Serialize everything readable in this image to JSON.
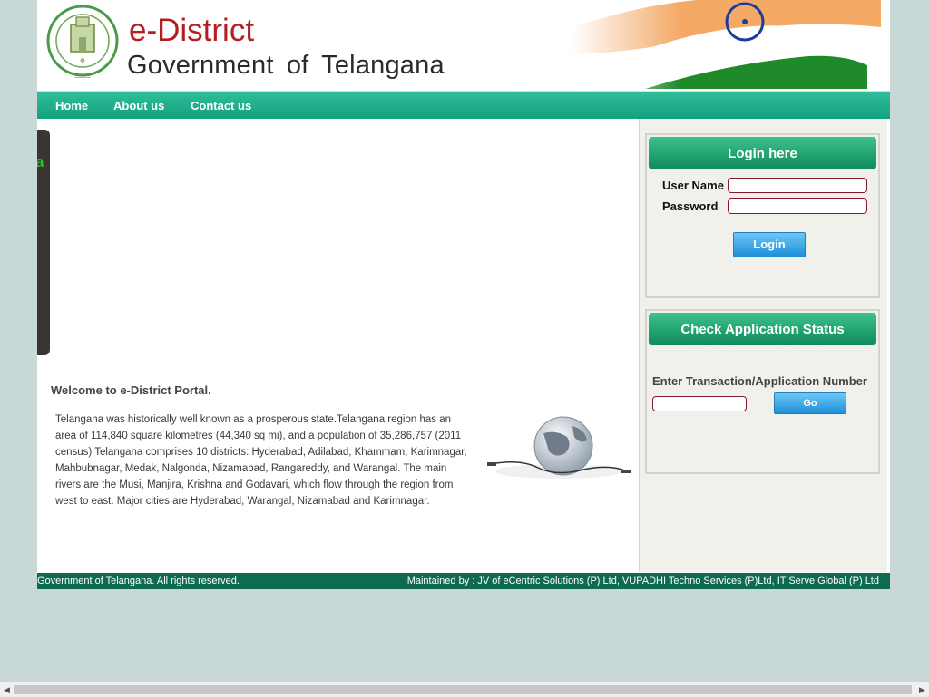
{
  "header": {
    "emblem_text": "GOVERNMENT OF TELANGANA",
    "title": "e-District",
    "subtitle": "Government  of Telangana"
  },
  "nav": {
    "items": [
      "Home",
      "About us",
      "Contact us"
    ]
  },
  "banner": {
    "fragment": "a"
  },
  "main": {
    "welcome": "Welcome to e-District Portal.",
    "intro": "Telangana was historically well known as a prosperous state.Telangana region has an area of 114,840 square kilometres (44,340 sq mi), and a population of 35,286,757 (2011 census) Telangana comprises 10 districts: Hyderabad, Adilabad, Khammam, Karimnagar, Mahbubnagar, Medak, Nalgonda, Nizamabad, Rangareddy, and Warangal. The main rivers are the Musi, Manjira, Krishna and Godavari, which flow through the region from west to east. Major cities are Hyderabad, Warangal, Nizamabad and Karimnagar."
  },
  "login": {
    "heading": "Login here",
    "username_label": "User Name",
    "password_label": "Password",
    "username_value": "",
    "password_value": "",
    "button": "Login"
  },
  "status": {
    "heading": "Check Application Status",
    "label": "Enter Transaction/Application Number",
    "input_value": "",
    "button": "Go"
  },
  "footer": {
    "left": "Government of Telangana. All rights reserved.",
    "right": "Maintained by : JV of eCentric Solutions (P) Ltd, VUPADHI Techno Services (P)Ltd, IT Serve Global (P) Ltd"
  },
  "colors": {
    "nav": "#1aa782",
    "footer": "#0f6b4f",
    "accent_red": "#b21e23",
    "header_green": "#10905f"
  }
}
